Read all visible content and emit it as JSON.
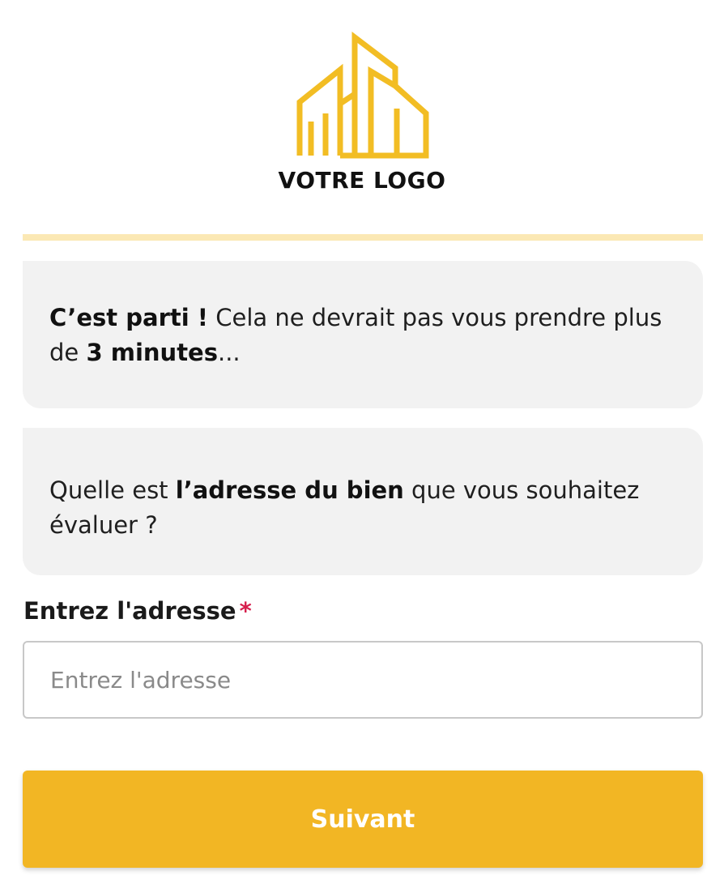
{
  "logo": {
    "text": "VOTRE LOGO",
    "icon": "building-logo-icon",
    "color": "#f2bd24"
  },
  "progress": {
    "value": 1.0
  },
  "messages": [
    {
      "bold_lead": "C’est parti !",
      "text": " Cela ne devrait pas vous prendre plus de ",
      "bold_mid": "3 minutes",
      "tail": "..."
    },
    {
      "lead": "Quelle est ",
      "bold_mid": "l’adresse du bien",
      "tail": " que vous souhaitez évaluer ?"
    }
  ],
  "form": {
    "label": "Entrez l'adresse",
    "required_marker": "*",
    "placeholder": "Entrez l'adresse",
    "value": ""
  },
  "next_button": {
    "label": "Suivant"
  },
  "colors": {
    "accent": "#f2b624",
    "progress_track": "#fbe8b4",
    "bubble_bg": "#f2f2f2",
    "required": "#d6204d"
  }
}
